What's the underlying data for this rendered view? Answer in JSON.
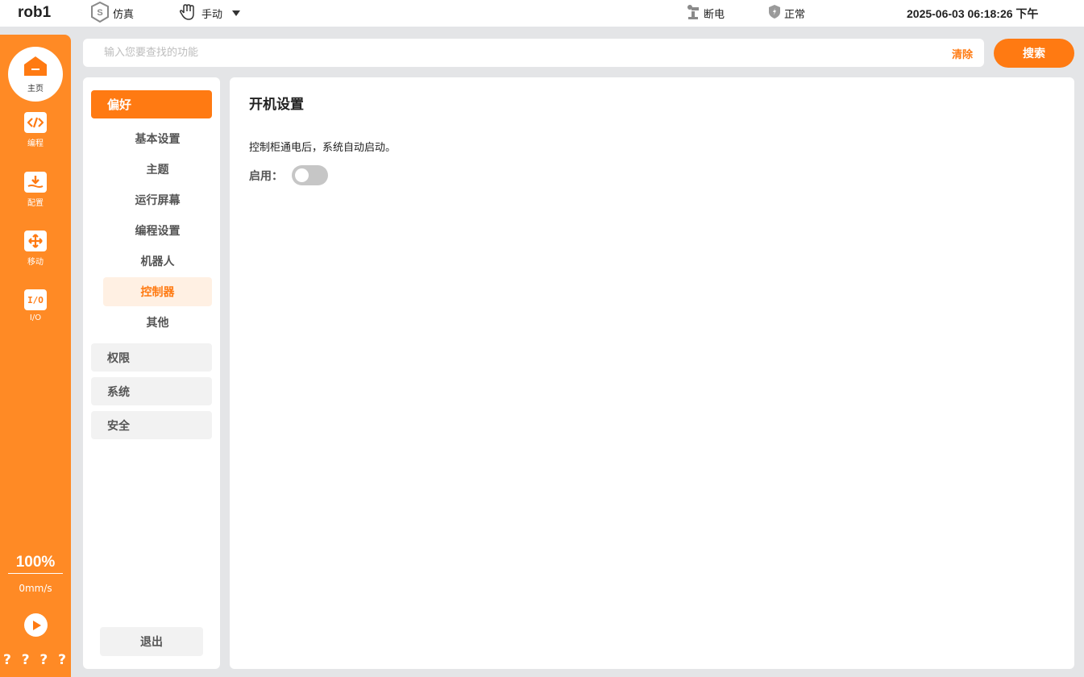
{
  "topbar": {
    "robot_name": "rob1",
    "sim_label": "仿真",
    "mode_label": "手动",
    "power_label": "断电",
    "safety_label": "正常",
    "datetime": "2025-06-03 06:18:26 下午"
  },
  "leftnav": {
    "home": "主页",
    "items": [
      "编程",
      "配置",
      "移动",
      "I/O"
    ],
    "io_icon_text": "I/O",
    "speed_percent": "100%",
    "speed_value": "0mm/s",
    "help_marks": [
      "?",
      "?",
      "?",
      "?"
    ]
  },
  "search": {
    "placeholder": "输入您要查找的功能",
    "clear_label": "清除",
    "search_label": "搜索"
  },
  "menu": {
    "active_group": "偏好",
    "sub_items": [
      "基本设置",
      "主题",
      "运行屏幕",
      "编程设置",
      "机器人",
      "控制器",
      "其他"
    ],
    "active_sub_index": 5,
    "groups": [
      "权限",
      "系统",
      "安全"
    ],
    "exit_label": "退出"
  },
  "content": {
    "title": "开机设置",
    "description": "控制柜通电后，系统自动启动。",
    "enable_label": "启用：",
    "enabled": false
  },
  "colors": {
    "accent": "#ff7a12",
    "nav_bg": "#ff8a25",
    "page_bg": "#e4e5e7"
  },
  "icons": [
    "sim-shield-icon",
    "hand-icon",
    "robot-arm-icon",
    "safety-shield-icon",
    "home-icon",
    "code-icon",
    "config-icon",
    "move-icon",
    "io-icon",
    "play-icon"
  ]
}
